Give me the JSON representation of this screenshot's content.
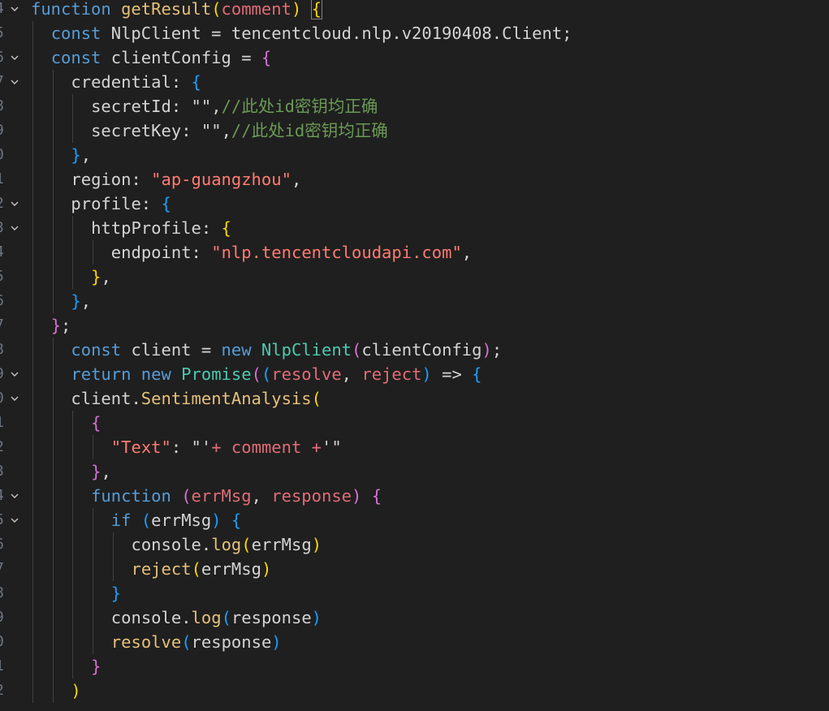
{
  "editor": {
    "line_numbers": [
      "4",
      "5",
      "6",
      "7",
      "8",
      "9",
      "0",
      "1",
      "2",
      "3",
      "4",
      "5",
      "6",
      "7",
      "8",
      "9",
      "0",
      "1",
      "2",
      "3",
      "4",
      "5",
      "6",
      "7",
      "8",
      "9",
      "0",
      "1",
      "2"
    ],
    "lines": [
      [
        [
          "fnk",
          "function"
        ],
        [
          "sp",
          " "
        ],
        [
          "fnname",
          "getResult"
        ],
        [
          "b1",
          "("
        ],
        [
          "pm",
          "comment"
        ],
        [
          "b1",
          ")"
        ],
        [
          "sp",
          " "
        ],
        [
          "b1h",
          "{"
        ]
      ],
      [
        [
          "kw",
          "const"
        ],
        [
          "sp",
          " "
        ],
        [
          "var",
          "NlpClient"
        ],
        [
          "op",
          " = "
        ],
        [
          "var",
          "tencentcloud.nlp.v20190408.Client;"
        ]
      ],
      [
        [
          "kw",
          "const"
        ],
        [
          "sp",
          " "
        ],
        [
          "var",
          "clientConfig"
        ],
        [
          "op",
          " = "
        ],
        [
          "b2",
          "{"
        ]
      ],
      [
        [
          "prop",
          "credential"
        ],
        [
          "op",
          ": "
        ],
        [
          "b3",
          "{"
        ]
      ],
      [
        [
          "prop",
          "secretId"
        ],
        [
          "op",
          ": "
        ],
        [
          "strq",
          "\"\""
        ],
        [
          "op",
          ","
        ],
        [
          "cmt",
          "//此处id密钥均正确"
        ]
      ],
      [
        [
          "prop",
          "secretKey"
        ],
        [
          "op",
          ": "
        ],
        [
          "strq",
          "\"\""
        ],
        [
          "op",
          ","
        ],
        [
          "cmt",
          "//此处id密钥均正确"
        ]
      ],
      [
        [
          "b3",
          "}"
        ],
        [
          "op",
          ","
        ]
      ],
      [
        [
          "prop",
          "region"
        ],
        [
          "op",
          ": "
        ],
        [
          "str",
          "\"ap-guangzhou\""
        ],
        [
          "op",
          ","
        ]
      ],
      [
        [
          "prop",
          "profile"
        ],
        [
          "op",
          ": "
        ],
        [
          "b3",
          "{"
        ]
      ],
      [
        [
          "prop",
          "httpProfile"
        ],
        [
          "op",
          ": "
        ],
        [
          "b1",
          "{"
        ]
      ],
      [
        [
          "prop",
          "endpoint"
        ],
        [
          "op",
          ": "
        ],
        [
          "str",
          "\"nlp.tencentcloudapi.com\""
        ],
        [
          "op",
          ","
        ]
      ],
      [
        [
          "b1",
          "}"
        ],
        [
          "op",
          ","
        ]
      ],
      [
        [
          "b3",
          "}"
        ],
        [
          "op",
          ","
        ]
      ],
      [
        [
          "b2",
          "}"
        ],
        [
          "op",
          ";"
        ]
      ],
      [
        [
          "kw",
          "const"
        ],
        [
          "sp",
          " "
        ],
        [
          "var",
          "client"
        ],
        [
          "op",
          " = "
        ],
        [
          "kw",
          "new"
        ],
        [
          "sp",
          " "
        ],
        [
          "cls",
          "NlpClient"
        ],
        [
          "b2",
          "("
        ],
        [
          "var",
          "clientConfig"
        ],
        [
          "b2",
          ")"
        ],
        [
          "op",
          ";"
        ]
      ],
      [
        [
          "kw",
          "return"
        ],
        [
          "sp",
          " "
        ],
        [
          "kw",
          "new"
        ],
        [
          "sp",
          " "
        ],
        [
          "cls",
          "Promise"
        ],
        [
          "b2",
          "("
        ],
        [
          "b3",
          "("
        ],
        [
          "pm",
          "resolve"
        ],
        [
          "op",
          ", "
        ],
        [
          "pm",
          "reject"
        ],
        [
          "b3",
          ")"
        ],
        [
          "op",
          " => "
        ],
        [
          "b3",
          "{"
        ]
      ],
      [
        [
          "var",
          "client."
        ],
        [
          "mth",
          "SentimentAnalysis"
        ],
        [
          "b1",
          "("
        ]
      ],
      [
        [
          "b2",
          "{"
        ]
      ],
      [
        [
          "str",
          "\"Text\""
        ],
        [
          "op",
          ": "
        ],
        [
          "strq",
          "\"'"
        ],
        [
          "pm",
          "+ comment +"
        ],
        [
          "strq",
          "'\""
        ]
      ],
      [
        [
          "b2",
          "}"
        ],
        [
          "op",
          ","
        ]
      ],
      [
        [
          "fnk",
          "function"
        ],
        [
          "sp",
          " "
        ],
        [
          "b2",
          "("
        ],
        [
          "pm",
          "errMsg"
        ],
        [
          "op",
          ", "
        ],
        [
          "pm",
          "response"
        ],
        [
          "b2",
          ")"
        ],
        [
          "sp",
          " "
        ],
        [
          "b2",
          "{"
        ]
      ],
      [
        [
          "kw",
          "if"
        ],
        [
          "sp",
          " "
        ],
        [
          "b3",
          "("
        ],
        [
          "var",
          "errMsg"
        ],
        [
          "b3",
          ")"
        ],
        [
          "sp",
          " "
        ],
        [
          "b3",
          "{"
        ]
      ],
      [
        [
          "var",
          "console."
        ],
        [
          "mth",
          "log"
        ],
        [
          "b1",
          "("
        ],
        [
          "var",
          "errMsg"
        ],
        [
          "b1",
          ")"
        ]
      ],
      [
        [
          "mth",
          "reject"
        ],
        [
          "b1",
          "("
        ],
        [
          "var",
          "errMsg"
        ],
        [
          "b1",
          ")"
        ]
      ],
      [
        [
          "b3",
          "}"
        ]
      ],
      [
        [
          "var",
          "console."
        ],
        [
          "mth",
          "log"
        ],
        [
          "b3",
          "("
        ],
        [
          "var",
          "response"
        ],
        [
          "b3",
          ")"
        ]
      ],
      [
        [
          "mth",
          "resolve"
        ],
        [
          "b3",
          "("
        ],
        [
          "var",
          "response"
        ],
        [
          "b3",
          ")"
        ]
      ],
      [
        [
          "b2",
          "}"
        ]
      ],
      [
        [
          "b1",
          ")"
        ]
      ]
    ],
    "indents": [
      0,
      1,
      1,
      2,
      3,
      3,
      2,
      2,
      2,
      3,
      4,
      3,
      2,
      1,
      2,
      2,
      2,
      3,
      4,
      3,
      3,
      4,
      5,
      5,
      4,
      4,
      4,
      3,
      2
    ],
    "foldable": [
      true,
      false,
      true,
      true,
      false,
      false,
      false,
      false,
      true,
      true,
      false,
      false,
      false,
      false,
      false,
      true,
      true,
      false,
      false,
      false,
      true,
      true,
      false,
      false,
      false,
      false,
      false,
      false,
      false
    ]
  },
  "colors": {
    "background": "#1f1f1f",
    "keyword": "#569cd6",
    "function_keyword": "#569cd6",
    "function_name": "#dcdcaa",
    "string": "#ce9178",
    "comment": "#6a9955",
    "class": "#4ec9b0"
  }
}
